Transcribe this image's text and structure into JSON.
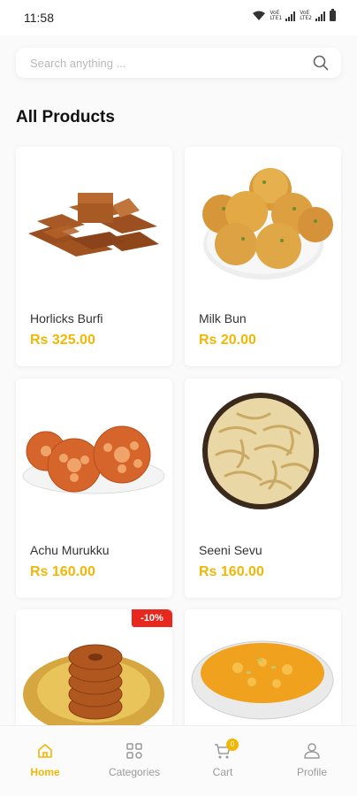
{
  "status_bar": {
    "time": "11:58",
    "sim1": [
      "VoE",
      "LTE1"
    ],
    "sim2": [
      "VoE",
      "LTE2"
    ]
  },
  "search": {
    "placeholder": "Search anything ...",
    "value": ""
  },
  "section_title": "All Products",
  "products": [
    {
      "name": "Horlicks Burfi",
      "price": "Rs 325.00"
    },
    {
      "name": "Milk Bun",
      "price": "Rs 20.00"
    },
    {
      "name": "Achu Murukku",
      "price": "Rs 160.00"
    },
    {
      "name": "Seeni Sevu",
      "price": "Rs 160.00"
    },
    {
      "name": "",
      "price": "",
      "badge": "-10%"
    },
    {
      "name": "",
      "price": ""
    }
  ],
  "bottom_nav": {
    "items": [
      {
        "label": "Home",
        "icon": "home-icon",
        "active": true
      },
      {
        "label": "Categories",
        "icon": "categories-icon",
        "active": false
      },
      {
        "label": "Cart",
        "icon": "cart-icon",
        "active": false
      },
      {
        "label": "Profile",
        "icon": "profile-icon",
        "active": false
      }
    ],
    "cart_count": "0"
  },
  "colors": {
    "accent": "#f2b705",
    "discount": "#e8271e",
    "background": "#fafafa"
  }
}
